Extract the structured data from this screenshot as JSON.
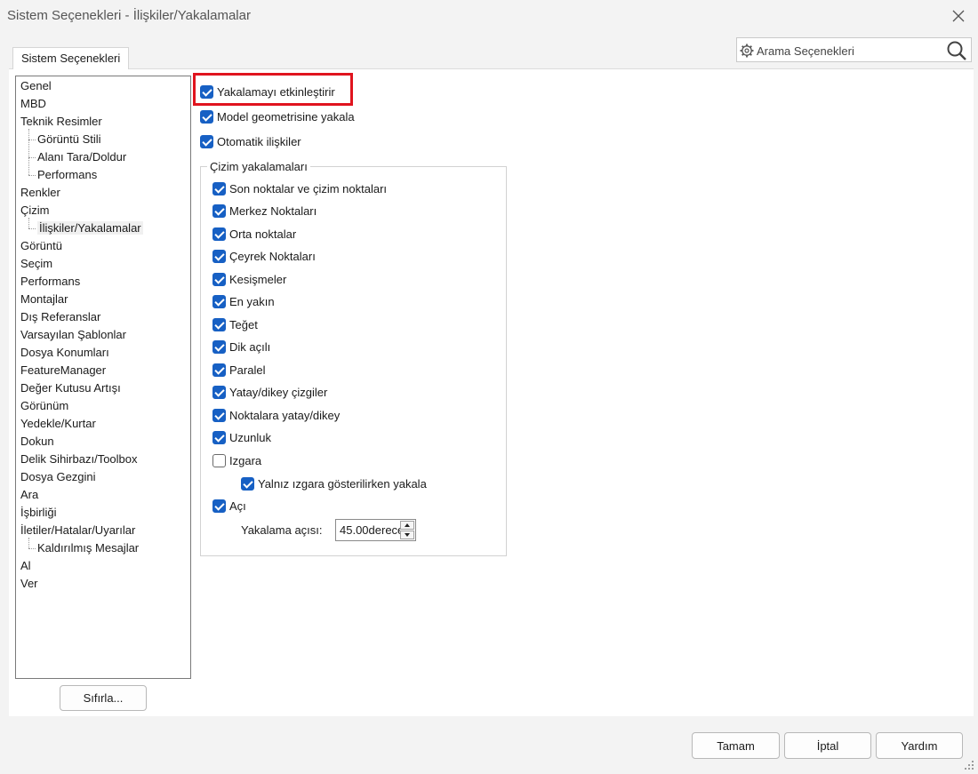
{
  "window": {
    "title": "Sistem Seçenekleri - İlişkiler/Yakalamalar"
  },
  "tabs": [
    {
      "label": "Sistem Seçenekleri"
    }
  ],
  "search": {
    "label": "Arama Seçenekleri"
  },
  "tree": {
    "items": [
      {
        "label": "Genel",
        "level": 0
      },
      {
        "label": "MBD",
        "level": 0
      },
      {
        "label": "Teknik Resimler",
        "level": 0
      },
      {
        "label": "Görüntü Stili",
        "level": 1
      },
      {
        "label": "Alanı Tara/Doldur",
        "level": 1
      },
      {
        "label": "Performans",
        "level": 1
      },
      {
        "label": "Renkler",
        "level": 0
      },
      {
        "label": "Çizim",
        "level": 0
      },
      {
        "label": "İlişkiler/Yakalamalar",
        "level": 1,
        "selected": true
      },
      {
        "label": "Görüntü",
        "level": 0
      },
      {
        "label": "Seçim",
        "level": 0
      },
      {
        "label": "Performans",
        "level": 0
      },
      {
        "label": "Montajlar",
        "level": 0
      },
      {
        "label": "Dış Referanslar",
        "level": 0
      },
      {
        "label": "Varsayılan Şablonlar",
        "level": 0
      },
      {
        "label": "Dosya Konumları",
        "level": 0
      },
      {
        "label": "FeatureManager",
        "level": 0
      },
      {
        "label": "Değer Kutusu Artışı",
        "level": 0
      },
      {
        "label": "Görünüm",
        "level": 0
      },
      {
        "label": "Yedekle/Kurtar",
        "level": 0
      },
      {
        "label": "Dokun",
        "level": 0
      },
      {
        "label": "Delik Sihirbazı/Toolbox",
        "level": 0
      },
      {
        "label": "Dosya Gezgini",
        "level": 0
      },
      {
        "label": "Ara",
        "level": 0
      },
      {
        "label": "İşbirliği",
        "level": 0
      },
      {
        "label": "İletiler/Hatalar/Uyarılar",
        "level": 0
      },
      {
        "label": "Kaldırılmış Mesajlar",
        "level": 1
      },
      {
        "label": "Al",
        "level": 0
      },
      {
        "label": "Ver",
        "level": 0
      }
    ]
  },
  "buttons": {
    "reset": "Sıfırla...",
    "ok": "Tamam",
    "cancel": "İptal",
    "help": "Yardım"
  },
  "options": {
    "top": [
      {
        "label": "Yakalamayı etkinleştirir",
        "checked": true
      },
      {
        "label": "Model geometrisine yakala",
        "checked": true
      },
      {
        "label": "Otomatik ilişkiler",
        "checked": true
      }
    ],
    "group_title": "Çizim yakalamaları",
    "snaps": [
      {
        "label": "Son noktalar ve çizim noktaları",
        "checked": true
      },
      {
        "label": "Merkez Noktaları",
        "checked": true
      },
      {
        "label": "Orta noktalar",
        "checked": true
      },
      {
        "label": "Çeyrek Noktaları",
        "checked": true
      },
      {
        "label": "Kesişmeler",
        "checked": true
      },
      {
        "label": "En yakın",
        "checked": true
      },
      {
        "label": "Teğet",
        "checked": true
      },
      {
        "label": "Dik açılı",
        "checked": true
      },
      {
        "label": "Paralel",
        "checked": true
      },
      {
        "label": "Yatay/dikey çizgiler",
        "checked": true
      },
      {
        "label": "Noktalara yatay/dikey",
        "checked": true
      },
      {
        "label": "Uzunluk",
        "checked": true
      },
      {
        "label": "Izgara",
        "checked": false
      },
      {
        "label": "Yalnız ızgara gösterilirken yakala",
        "checked": true,
        "indent": true
      },
      {
        "label": "Açı",
        "checked": true
      }
    ],
    "snap_angle": {
      "label": "Yakalama açısı:",
      "value": "45.00derece"
    }
  },
  "colors": {
    "accent": "#1760c4",
    "highlight": "#e0141e"
  }
}
